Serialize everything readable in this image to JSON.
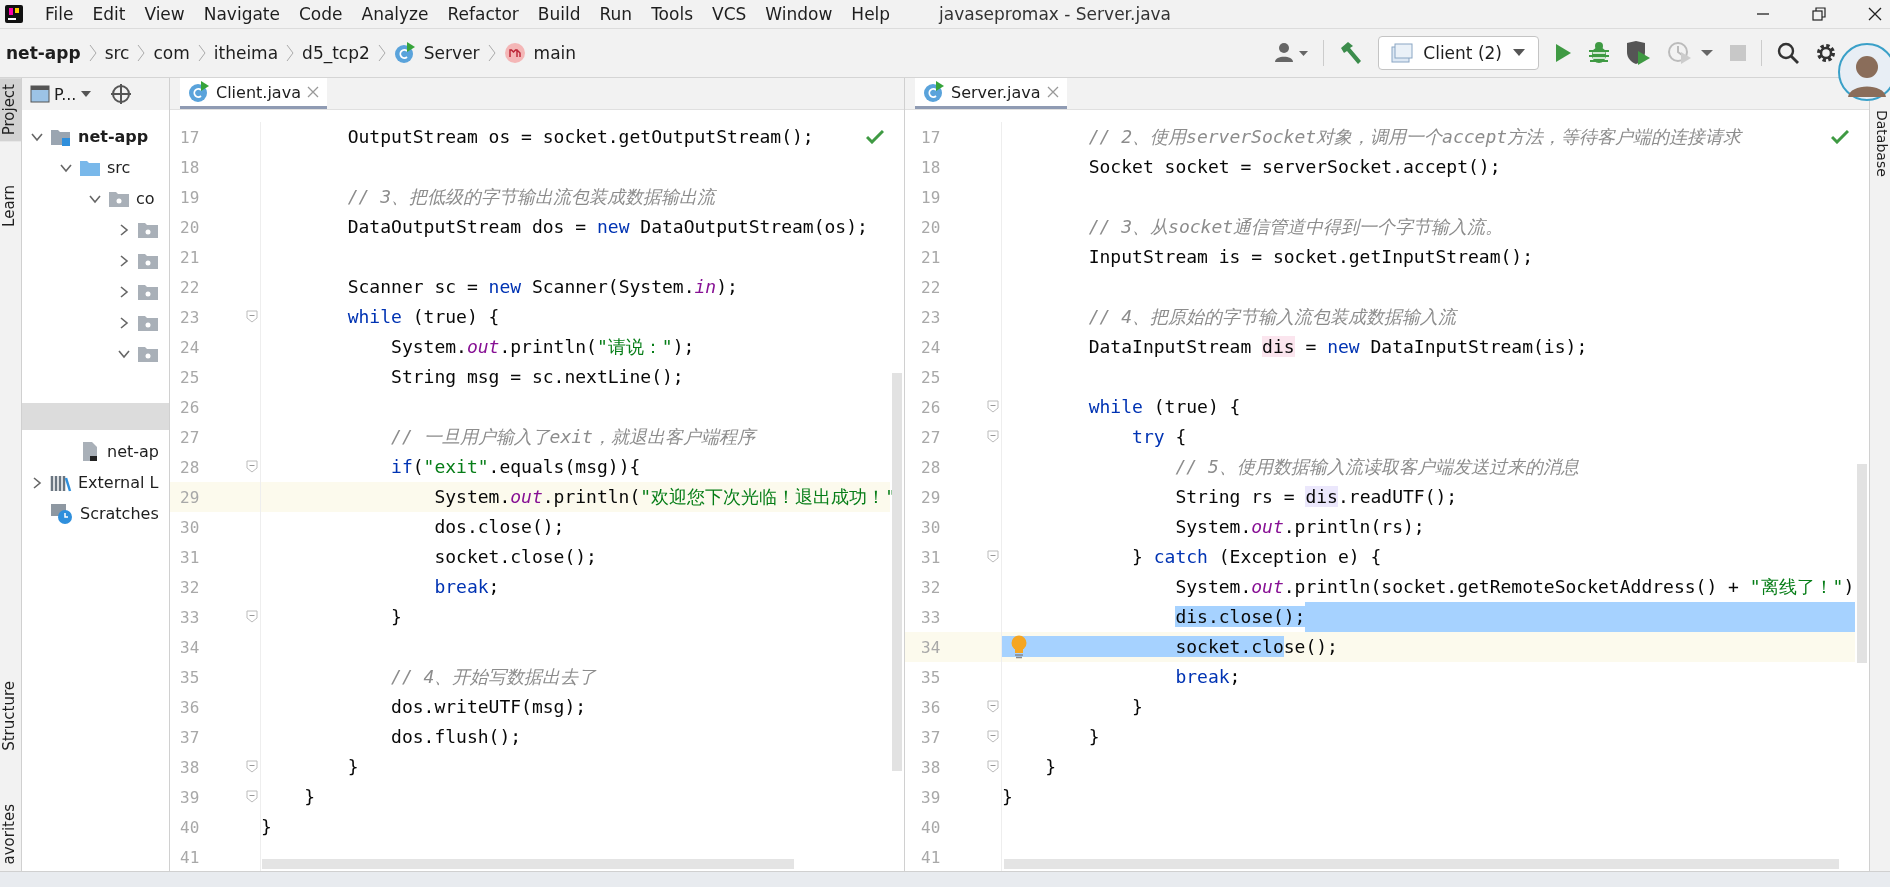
{
  "menu_bar": {
    "items": [
      "File",
      "Edit",
      "View",
      "Navigate",
      "Code",
      "Analyze",
      "Refactor",
      "Build",
      "Run",
      "Tools",
      "VCS",
      "Window",
      "Help"
    ],
    "title": "javasepromax - Server.java"
  },
  "breadcrumbs": [
    {
      "label": "net-app",
      "kind": "module"
    },
    {
      "label": "src",
      "kind": "folder"
    },
    {
      "label": "com",
      "kind": "folder"
    },
    {
      "label": "itheima",
      "kind": "folder"
    },
    {
      "label": "d5_tcp2",
      "kind": "folder"
    },
    {
      "label": "Server",
      "kind": "class"
    },
    {
      "label": "main",
      "kind": "method"
    }
  ],
  "toolbar": {
    "run_configuration": "Client (2)"
  },
  "left_tool_stripe": [
    {
      "label": "Project",
      "selected": true
    },
    {
      "label": "Learn",
      "selected": false
    },
    {
      "label": "Structure",
      "selected": false
    },
    {
      "label": "avorites",
      "selected": false
    }
  ],
  "right_tool_stripe": [
    {
      "label": "Database"
    }
  ],
  "project_panel": {
    "title": "P...",
    "tree": [
      {
        "label": "net-app",
        "kind": "module",
        "expanded": true,
        "children": [
          {
            "label": "src",
            "kind": "source",
            "expanded": true,
            "children": [
              {
                "label": "co",
                "kind": "package",
                "expanded": true,
                "children": [
                  {
                    "kind": "package",
                    "expanded": false
                  },
                  {
                    "kind": "package",
                    "expanded": false
                  },
                  {
                    "kind": "package",
                    "expanded": false
                  },
                  {
                    "kind": "package",
                    "expanded": false
                  },
                  {
                    "kind": "package",
                    "expanded": true
                  }
                ]
              }
            ]
          },
          {
            "label": "net-ap",
            "kind": "module-file"
          }
        ]
      },
      {
        "label": "External L",
        "kind": "libraries",
        "expanded": false
      },
      {
        "label": "Scratches",
        "kind": "scratches"
      }
    ]
  },
  "editors": [
    {
      "tab": {
        "label": "Client.java",
        "selected": true
      },
      "lines": [
        {
          "number": "17",
          "fold": false,
          "current": false,
          "tokens": [
            {
              "text": "        OutputStream os = socket.getOutputStream();",
              "kind": "plain"
            }
          ]
        },
        {
          "number": "18",
          "fold": false,
          "current": false
        },
        {
          "number": "19",
          "fold": false,
          "current": false,
          "tokens": [
            {
              "text": "        // 3、把低级的字节输出流包装成数据输出流",
              "kind": "comment"
            }
          ]
        },
        {
          "number": "20",
          "fold": false,
          "current": false,
          "tokens": [
            {
              "text": "        DataOutputStream dos = ",
              "kind": "plain"
            },
            {
              "text": "new",
              "kind": "keyword"
            },
            {
              "text": " DataOutputStream(os);",
              "kind": "plain"
            }
          ]
        },
        {
          "number": "21",
          "fold": false,
          "current": false
        },
        {
          "number": "22",
          "fold": false,
          "current": false,
          "tokens": [
            {
              "text": "        Scanner sc = ",
              "kind": "plain"
            },
            {
              "text": "new",
              "kind": "keyword"
            },
            {
              "text": " Scanner(System.",
              "kind": "plain"
            },
            {
              "text": "in",
              "kind": "field"
            },
            {
              "text": ");",
              "kind": "plain"
            }
          ]
        },
        {
          "number": "23",
          "fold": true,
          "current": false,
          "tokens": [
            {
              "text": "        while",
              "kind": "keyword"
            },
            {
              "text": " (true) {",
              "kind": "plain"
            }
          ]
        },
        {
          "number": "24",
          "fold": false,
          "current": false,
          "tokens": [
            {
              "text": "            System.",
              "kind": "plain"
            },
            {
              "text": "out",
              "kind": "field"
            },
            {
              "text": ".println(",
              "kind": "plain"
            },
            {
              "text": "\"请说：\"",
              "kind": "string"
            },
            {
              "text": ");",
              "kind": "plain"
            }
          ]
        },
        {
          "number": "25",
          "fold": false,
          "current": false,
          "tokens": [
            {
              "text": "            String msg = sc.nextLine();",
              "kind": "plain"
            }
          ]
        },
        {
          "number": "26",
          "fold": false,
          "current": false
        },
        {
          "number": "27",
          "fold": false,
          "current": false,
          "tokens": [
            {
              "text": "            // 一旦用户输入了exit，就退出客户端程序",
              "kind": "comment"
            }
          ]
        },
        {
          "number": "28",
          "fold": true,
          "current": false,
          "tokens": [
            {
              "text": "            if",
              "kind": "keyword"
            },
            {
              "text": "(",
              "kind": "plain"
            },
            {
              "text": "\"exit\"",
              "kind": "string"
            },
            {
              "text": ".equals(msg)){",
              "kind": "plain"
            }
          ]
        },
        {
          "number": "29",
          "fold": false,
          "current": true,
          "tokens": [
            {
              "text": "                System.",
              "kind": "plain"
            },
            {
              "text": "out",
              "kind": "field"
            },
            {
              "text": ".println(",
              "kind": "plain"
            },
            {
              "text": "\"欢迎您下次光临！退出成功！\"",
              "kind": "string"
            }
          ]
        },
        {
          "number": "30",
          "fold": false,
          "current": false,
          "tokens": [
            {
              "text": "                dos.close();",
              "kind": "plain"
            }
          ]
        },
        {
          "number": "31",
          "fold": false,
          "current": false,
          "tokens": [
            {
              "text": "                socket.close();",
              "kind": "plain"
            }
          ]
        },
        {
          "number": "32",
          "fold": false,
          "current": false,
          "tokens": [
            {
              "text": "                break",
              "kind": "keyword"
            },
            {
              "text": ";",
              "kind": "plain"
            }
          ]
        },
        {
          "number": "33",
          "fold": true,
          "current": false,
          "tokens": [
            {
              "text": "            }",
              "kind": "plain"
            }
          ]
        },
        {
          "number": "34",
          "fold": false,
          "current": false
        },
        {
          "number": "35",
          "fold": false,
          "current": false,
          "tokens": [
            {
              "text": "            // 4、开始写数据出去了",
              "kind": "comment"
            }
          ]
        },
        {
          "number": "36",
          "fold": false,
          "current": false,
          "tokens": [
            {
              "text": "            dos.writeUTF(msg);",
              "kind": "plain"
            }
          ]
        },
        {
          "number": "37",
          "fold": false,
          "current": false,
          "tokens": [
            {
              "text": "            dos.flush();",
              "kind": "plain"
            }
          ]
        },
        {
          "number": "38",
          "fold": true,
          "current": false,
          "tokens": [
            {
              "text": "        }",
              "kind": "plain"
            }
          ]
        },
        {
          "number": "39",
          "fold": true,
          "current": false,
          "tokens": [
            {
              "text": "    }",
              "kind": "plain"
            }
          ]
        },
        {
          "number": "40",
          "fold": false,
          "current": false,
          "tokens": [
            {
              "text": "}",
              "kind": "plain"
            }
          ]
        },
        {
          "number": "41",
          "fold": false,
          "current": false
        }
      ]
    },
    {
      "tab": {
        "label": "Server.java",
        "selected": true
      },
      "lines": [
        {
          "number": "17",
          "fold": false,
          "current": false,
          "tokens": [
            {
              "text": "        // 2、使用serverSocket对象，调用一个accept方法，等待客户端的连接请求",
              "kind": "comment"
            }
          ]
        },
        {
          "number": "18",
          "fold": false,
          "current": false,
          "tokens": [
            {
              "text": "        Socket socket = serverSocket.accept();",
              "kind": "plain"
            }
          ]
        },
        {
          "number": "19",
          "fold": false,
          "current": false
        },
        {
          "number": "20",
          "fold": false,
          "current": false,
          "tokens": [
            {
              "text": "        // 3、从socket通信管道中得到一个字节输入流。",
              "kind": "comment"
            }
          ]
        },
        {
          "number": "21",
          "fold": false,
          "current": false,
          "tokens": [
            {
              "text": "        InputStream is = socket.getInputStream();",
              "kind": "plain"
            }
          ]
        },
        {
          "number": "22",
          "fold": false,
          "current": false
        },
        {
          "number": "23",
          "fold": false,
          "current": false,
          "tokens": [
            {
              "text": "        // 4、把原始的字节输入流包装成数据输入流",
              "kind": "comment"
            }
          ]
        },
        {
          "number": "24",
          "fold": false,
          "current": false,
          "tokens": [
            {
              "text": "        DataInputStream ",
              "kind": "plain"
            },
            {
              "text": "dis",
              "kind": "usage_write"
            },
            {
              "text": " = ",
              "kind": "plain"
            },
            {
              "text": "new",
              "kind": "keyword"
            },
            {
              "text": " DataInputStream(is);",
              "kind": "plain"
            }
          ]
        },
        {
          "number": "25",
          "fold": false,
          "current": false
        },
        {
          "number": "26",
          "fold": true,
          "current": false,
          "tokens": [
            {
              "text": "        while",
              "kind": "keyword"
            },
            {
              "text": " (true) {",
              "kind": "plain"
            }
          ]
        },
        {
          "number": "27",
          "fold": true,
          "current": false,
          "tokens": [
            {
              "text": "            try",
              "kind": "keyword"
            },
            {
              "text": " {",
              "kind": "plain"
            }
          ]
        },
        {
          "number": "28",
          "fold": false,
          "current": false,
          "tokens": [
            {
              "text": "                // 5、使用数据输入流读取客户端发送过来的消息",
              "kind": "comment"
            }
          ]
        },
        {
          "number": "29",
          "fold": false,
          "current": false,
          "tokens": [
            {
              "text": "                String rs = ",
              "kind": "plain"
            },
            {
              "text": "dis",
              "kind": "usage_read"
            },
            {
              "text": ".readUTF();",
              "kind": "plain"
            }
          ]
        },
        {
          "number": "30",
          "fold": false,
          "current": false,
          "tokens": [
            {
              "text": "                System.",
              "kind": "plain"
            },
            {
              "text": "out",
              "kind": "field"
            },
            {
              "text": ".println(rs);",
              "kind": "plain"
            }
          ]
        },
        {
          "number": "31",
          "fold": true,
          "current": false,
          "tokens": [
            {
              "text": "            } ",
              "kind": "plain"
            },
            {
              "text": "catch",
              "kind": "keyword"
            },
            {
              "text": " (Exception e) {",
              "kind": "plain"
            }
          ]
        },
        {
          "number": "32",
          "fold": false,
          "current": false,
          "tokens": [
            {
              "text": "                System.",
              "kind": "plain"
            },
            {
              "text": "out",
              "kind": "field"
            },
            {
              "text": ".println(socket.getRemoteSocketAddress() + ",
              "kind": "plain"
            },
            {
              "text": "\"离线了！\"",
              "kind": "string"
            },
            {
              "text": ")",
              "kind": "plain"
            }
          ]
        },
        {
          "number": "33",
          "fold": false,
          "current": false,
          "selected_tail": true,
          "tokens": [
            {
              "text": "                dis.close();",
              "kind": "selection_start"
            }
          ]
        },
        {
          "number": "34",
          "fold": false,
          "current": true,
          "intention_bulb": true,
          "tokens": [
            {
              "text": "                socket.clo",
              "kind": "selected"
            },
            {
              "text": "se();",
              "kind": "plain"
            }
          ]
        },
        {
          "number": "35",
          "fold": false,
          "current": false,
          "tokens": [
            {
              "text": "                break",
              "kind": "keyword"
            },
            {
              "text": ";",
              "kind": "plain"
            }
          ]
        },
        {
          "number": "36",
          "fold": true,
          "current": false,
          "tokens": [
            {
              "text": "            }",
              "kind": "plain"
            }
          ]
        },
        {
          "number": "37",
          "fold": true,
          "current": false,
          "tokens": [
            {
              "text": "        }",
              "kind": "plain"
            }
          ]
        },
        {
          "number": "38",
          "fold": true,
          "current": false,
          "tokens": [
            {
              "text": "    }",
              "kind": "plain"
            }
          ]
        },
        {
          "number": "39",
          "fold": false,
          "current": false,
          "tokens": [
            {
              "text": "}",
              "kind": "plain"
            }
          ]
        },
        {
          "number": "40",
          "fold": false,
          "current": false
        },
        {
          "number": "41",
          "fold": false,
          "current": false
        }
      ]
    }
  ]
}
